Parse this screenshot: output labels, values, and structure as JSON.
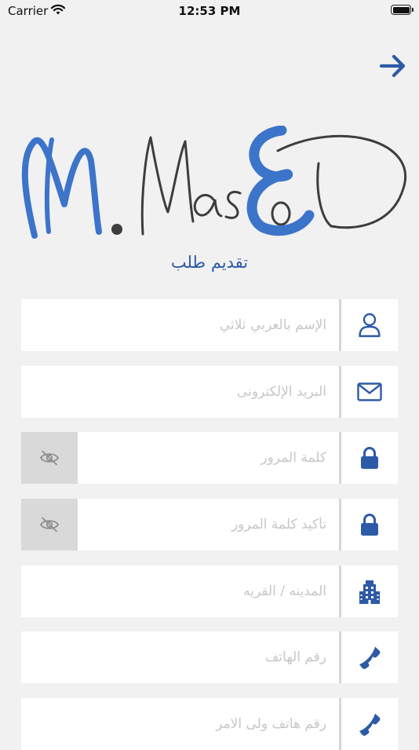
{
  "status_bar": {
    "carrier": "Carrier",
    "time": "12:53 PM"
  },
  "logo": {
    "text": "M.MasoD"
  },
  "page_title": "تقديم طلب",
  "fields": [
    {
      "icon": "person-icon",
      "placeholder": "الإسم بالعربي ثلاثي"
    },
    {
      "icon": "envelope-icon",
      "placeholder": "البريد الإلكترونى"
    },
    {
      "icon": "lock-icon",
      "placeholder": "كلمة المرور",
      "toggle_icon": "eye-slash-icon"
    },
    {
      "icon": "lock-icon",
      "placeholder": "تأكيد كلمة المرور",
      "toggle_icon": "eye-slash-icon"
    },
    {
      "icon": "building-icon",
      "placeholder": "المدينه / القريه"
    },
    {
      "icon": "phone-icon",
      "placeholder": "رقم الهاتف"
    },
    {
      "icon": "phone-icon",
      "placeholder": "رقم هاتف ولى الامر"
    }
  ],
  "colors": {
    "accent": "#2d5aa6",
    "background": "#f1f1f1",
    "logo_blue": "#3c74c9",
    "logo_dark": "#3d3d3d"
  }
}
